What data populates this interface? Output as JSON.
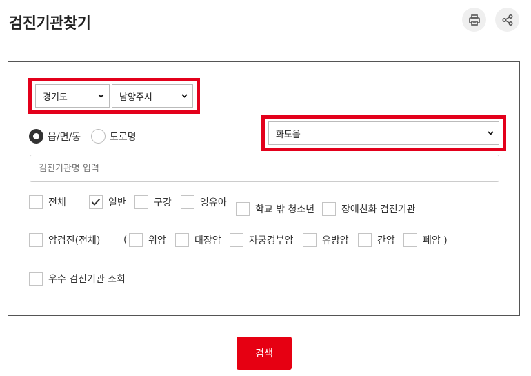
{
  "page": {
    "title": "검진기관찾기"
  },
  "header": {
    "print_icon": "printer-icon",
    "share_icon": "share-icon"
  },
  "region": {
    "province": "경기도",
    "city": "남양주시",
    "town": "화도읍"
  },
  "address_type": {
    "option_1": "읍/면/동",
    "option_2": "도로명",
    "selected": "읍/면/동"
  },
  "search": {
    "placeholder": "검진기관명 입력"
  },
  "checkboxes": {
    "all": "전체",
    "general": "일반",
    "oral": "구강",
    "infant": "영유아",
    "school": "학교 밖 청소년",
    "disability": "장애친화 검진기관",
    "cancer_all": "암검진(전체)",
    "open_paren": "(",
    "stomach": "위암",
    "colon": "대장암",
    "cervical": "자궁경부암",
    "breast": "유방암",
    "liver": "간암",
    "lung": "폐암 )",
    "excellent": "우수 검진기관 조회"
  },
  "checked": [
    "일반"
  ],
  "colors": {
    "accent_red": "#e3001b",
    "button_red": "#e60012"
  },
  "actions": {
    "search_label": "검색"
  }
}
